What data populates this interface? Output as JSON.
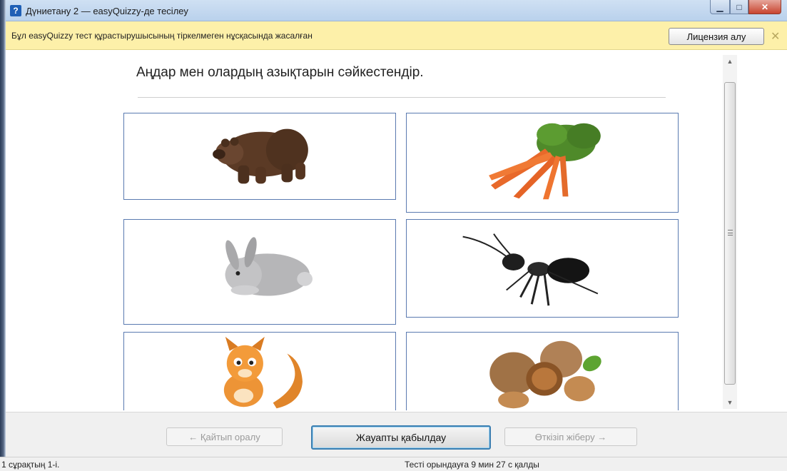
{
  "window": {
    "title": "Дүниетану 2 — easyQuizzy-де тесілеу",
    "icon": "question-mark-icon",
    "controls": [
      "minimize-icon",
      "maximize-icon",
      "close-icon"
    ]
  },
  "license_bar": {
    "message": "Бұл easyQuizzy тест құрастырушысының тіркелмеген нұсқасында жасалған",
    "button_label": "Лицензия алу",
    "close_glyph": "✕"
  },
  "question": {
    "text": "Аңдар мен олардың азықтарын сәйкестендір.",
    "cards": [
      {
        "column": "left",
        "picture": "bear"
      },
      {
        "column": "right",
        "picture": "carrots"
      },
      {
        "column": "left",
        "picture": "rabbit"
      },
      {
        "column": "right",
        "picture": "ant"
      },
      {
        "column": "left",
        "picture": "squirrel"
      },
      {
        "column": "right",
        "picture": "walnuts"
      }
    ]
  },
  "toolbar": {
    "back_label": "← Қайтып оралу",
    "accept_label": "Жауапты қабылдау",
    "skip_label": "Өткізіп жіберу →"
  },
  "status": {
    "progress": "1 сұрақтың 1-і.",
    "time_left": "Тесті орындауға 9 мин 27 с қалды"
  },
  "colors": {
    "title_bar": "#c4d8ef",
    "license_bar": "#fdf0a9",
    "card_border": "#5a7ab0",
    "accept_focus": "#3c7fb1"
  }
}
